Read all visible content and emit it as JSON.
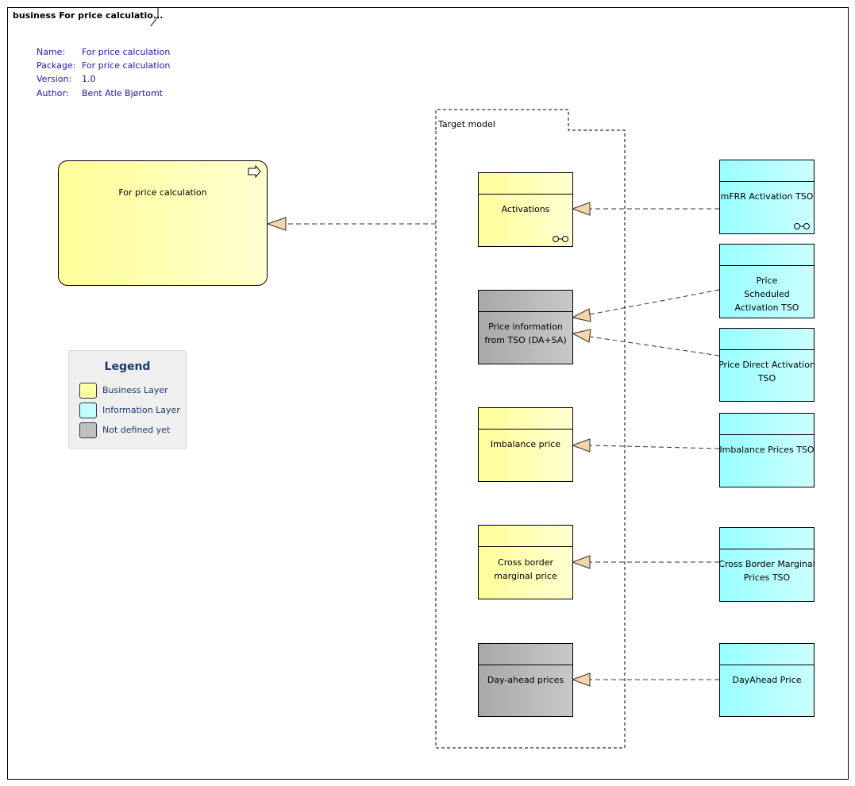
{
  "frame": {
    "title": "business For price calculatio..."
  },
  "meta": {
    "rows": [
      {
        "key": "Name:",
        "value": "For price calculation"
      },
      {
        "key": "Package:",
        "value": "For price calculation"
      },
      {
        "key": "Version:",
        "value": "1.0"
      },
      {
        "key": "Author:",
        "value": "Bent Atle Bjørtomt"
      }
    ]
  },
  "main_node": {
    "label": "For price calculation",
    "icon": "business-process-arrow-icon"
  },
  "package": {
    "label": "Target model"
  },
  "business_objects": [
    {
      "label": "Activations",
      "layer": "business",
      "has_interface_icon": true
    },
    {
      "label": "Price information from TSO (DA+SA)",
      "layer": "not-defined"
    },
    {
      "label": "Imbalance price",
      "layer": "business"
    },
    {
      "label": "Cross border marginal price",
      "layer": "business"
    },
    {
      "label": "Day-ahead prices",
      "layer": "not-defined"
    }
  ],
  "information_objects": [
    {
      "label": "mFRR Activation TSO",
      "has_interface_icon": true
    },
    {
      "label": "Price Scheduled Activation TSO"
    },
    {
      "label": "Price Direct Activation TSO"
    },
    {
      "label": "Imbalance Prices TSO"
    },
    {
      "label": "Cross Border Marginal Prices TSO"
    },
    {
      "label": "DayAhead Price"
    }
  ],
  "relations": [
    {
      "from": "Target model",
      "to": "For price calculation",
      "type": "realization"
    },
    {
      "from": "mFRR Activation TSO",
      "to": "Activations",
      "type": "realization"
    },
    {
      "from": "Price Scheduled Activation TSO",
      "to": "Price information from TSO (DA+SA)",
      "type": "realization"
    },
    {
      "from": "Price Direct Activation TSO",
      "to": "Price information from TSO (DA+SA)",
      "type": "realization"
    },
    {
      "from": "Imbalance Prices TSO",
      "to": "Imbalance price",
      "type": "realization"
    },
    {
      "from": "Cross Border Marginal Prices TSO",
      "to": "Cross border marginal price",
      "type": "realization"
    },
    {
      "from": "DayAhead Price",
      "to": "Day-ahead prices",
      "type": "realization"
    }
  ],
  "legend": {
    "title": "Legend",
    "items": [
      {
        "label": "Business Layer",
        "color": "#ffffa8"
      },
      {
        "label": "Information Layer",
        "color": "#c0ffff"
      },
      {
        "label": "Not defined yet",
        "color": "#c0c0c0"
      }
    ]
  },
  "colors": {
    "business": "#ffff99",
    "information": "#99ffff",
    "not_defined": "#b4b4b4",
    "arrowhead": "#f5d6a8",
    "meta_text": "#1a1aa6"
  }
}
